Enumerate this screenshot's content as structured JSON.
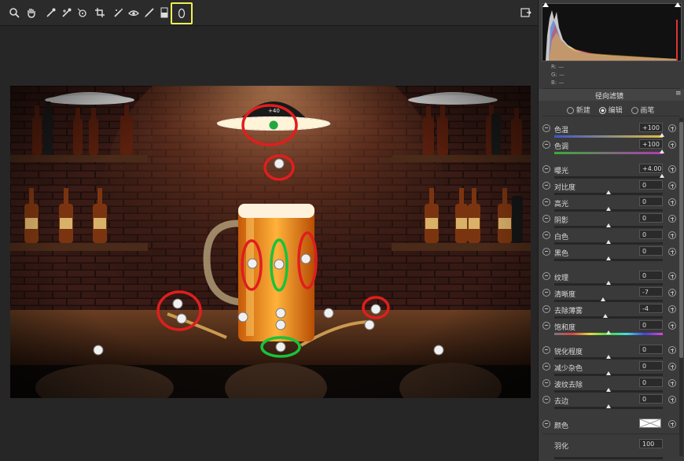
{
  "toolbar": {
    "tools": [
      "zoom-icon",
      "hand-icon",
      "white-balance-icon",
      "color-sampler-icon",
      "target-adjust-icon",
      "crop-icon",
      "spot-removal-icon",
      "red-eye-icon",
      "adjustment-brush-icon",
      "graduated-filter-icon",
      "radial-filter-icon"
    ],
    "preview_icon": "open-preview-icon"
  },
  "histogram": {
    "r_label": "R:",
    "g_label": "G:",
    "b_label": "B:",
    "r_value": "—",
    "g_value": "—",
    "b_value": "—"
  },
  "panel": {
    "title": "径向滤镜",
    "modes": [
      "新建",
      "编辑",
      "画笔"
    ],
    "selected_mode": "编辑",
    "rows": [
      {
        "label": "色温",
        "value": "+100"
      },
      {
        "label": "色调",
        "value": "+100"
      },
      {
        "label": "曝光",
        "value": "+4.00"
      },
      {
        "label": "对比度",
        "value": "0"
      },
      {
        "label": "高光",
        "value": "0"
      },
      {
        "label": "阴影",
        "value": "0"
      },
      {
        "label": "白色",
        "value": "0"
      },
      {
        "label": "黑色",
        "value": "0"
      },
      {
        "label": "纹理",
        "value": "0"
      },
      {
        "label": "清晰度",
        "value": "-7"
      },
      {
        "label": "去除薄雾",
        "value": "-4"
      },
      {
        "label": "饱和度",
        "value": "0"
      },
      {
        "label": "锐化程度",
        "value": "0"
      },
      {
        "label": "减少杂色",
        "value": "0"
      },
      {
        "label": "波纹去除",
        "value": "0"
      },
      {
        "label": "去边",
        "value": "0"
      }
    ],
    "color_label": "颜色",
    "feather_label": "羽化",
    "feather_value": "100"
  },
  "overlay": {
    "top_pin_label": "+40"
  },
  "colors": {
    "highlight_box": "#f2ee57",
    "red_marker": "#e01e1e",
    "green_marker": "#19c23a"
  }
}
